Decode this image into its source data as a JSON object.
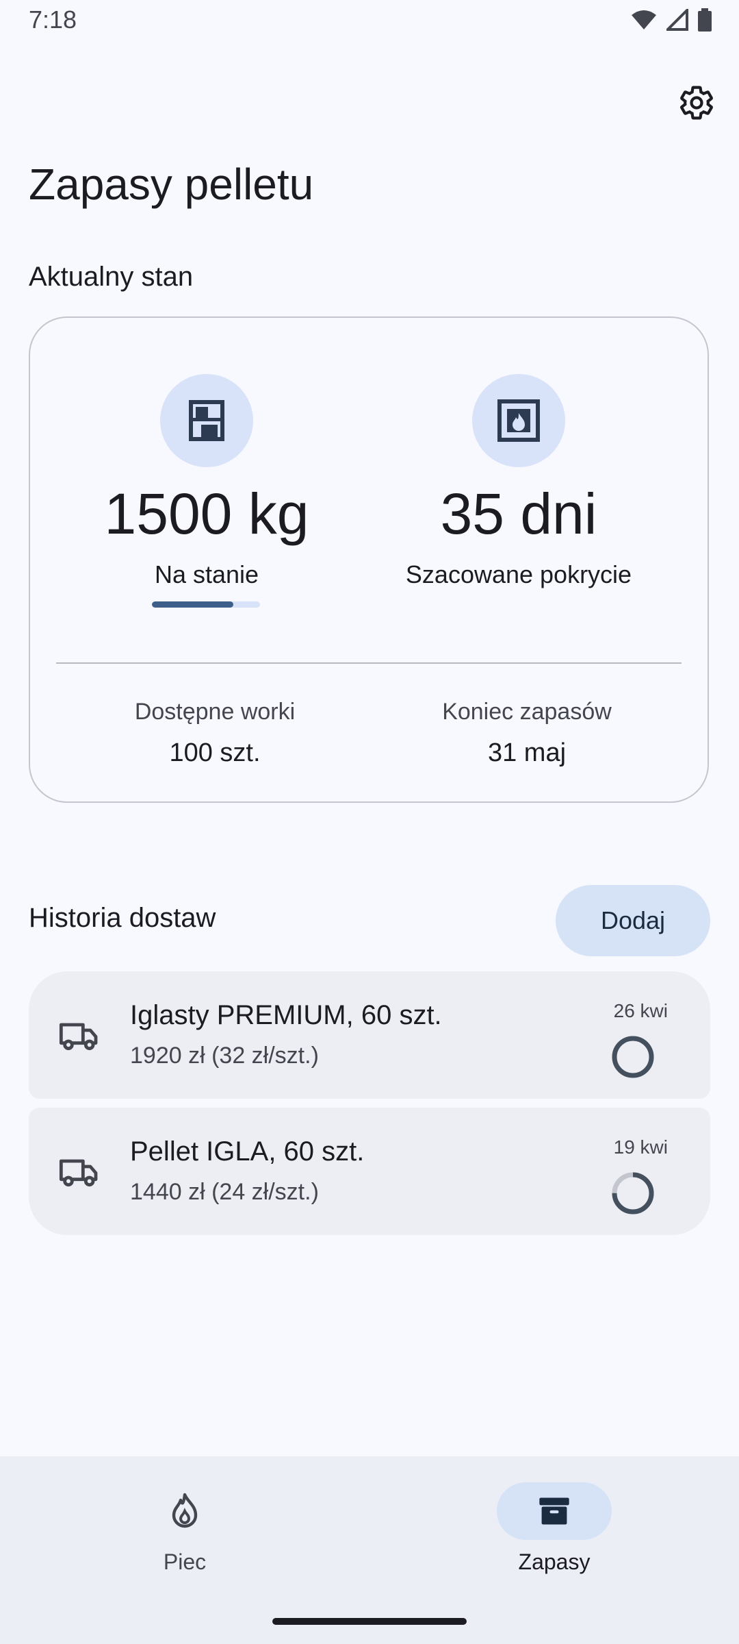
{
  "status_bar": {
    "time": "7:18",
    "icons": [
      "wifi-icon",
      "signal-icon",
      "battery-icon"
    ]
  },
  "header": {
    "title": "Zapasy pelletu",
    "settings_icon": "gear-icon"
  },
  "current_status": {
    "section_label": "Aktualny stan",
    "stock": {
      "icon": "shelves-icon",
      "value": "1500 kg",
      "caption": "Na stanie",
      "progress_fraction": 0.75
    },
    "coverage": {
      "icon": "fireplace-icon",
      "value": "35 dni",
      "caption": "Szacowane pokrycie"
    },
    "bags": {
      "label": "Dostępne worki",
      "value": "100 szt."
    },
    "end_of_stock": {
      "label": "Koniec zapasów",
      "value": "31 maj"
    }
  },
  "deliveries": {
    "title": "Historia dostaw",
    "add_label": "Dodaj",
    "items": [
      {
        "icon": "truck-icon",
        "title": "Iglasty PREMIUM, 60 szt.",
        "subtitle": "1920 zł (32 zł/szt.)",
        "date": "26 kwi",
        "used_fraction": 1.0
      },
      {
        "icon": "truck-icon",
        "title": "Pellet IGLA, 60 szt.",
        "subtitle": "1440 zł (24 zł/szt.)",
        "date": "19 kwi",
        "used_fraction": 0.75
      }
    ]
  },
  "bottom_nav": {
    "items": [
      {
        "label": "Piec",
        "icon": "flame-icon",
        "active": false
      },
      {
        "label": "Zapasy",
        "icon": "archive-box-icon",
        "active": true
      }
    ]
  },
  "colors": {
    "background": "#f8f9ff",
    "accent": "#3e5f8a",
    "accent_container": "#d6e3f7",
    "card_surface": "#edeef4"
  }
}
